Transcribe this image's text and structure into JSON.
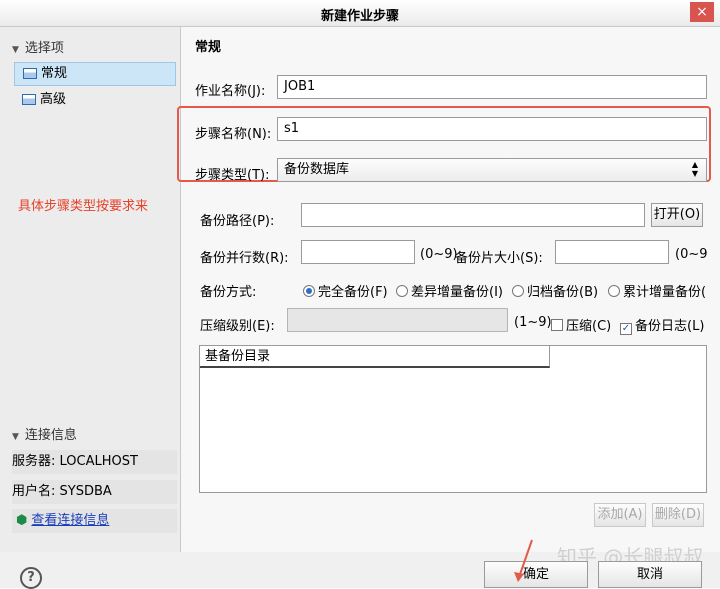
{
  "window": {
    "title": "新建作业步骤",
    "close": "×"
  },
  "sidebar": {
    "section_title": "选择项",
    "items": [
      {
        "label": "常规"
      },
      {
        "label": "高级"
      }
    ],
    "annotation": "具体步骤类型按要求来",
    "connection": {
      "title": "连接信息",
      "server": "服务器: LOCALHOST",
      "user": "用户名: SYSDBA",
      "link": "查看连接信息"
    }
  },
  "general": {
    "heading": "常规",
    "job_name_label": "作业名称(J):",
    "job_name_value": "JOB1",
    "step_name_label": "步骤名称(N):",
    "step_name_value": "s1",
    "step_type_label": "步骤类型(T):",
    "step_type_value": "备份数据库",
    "backup_path_label": "备份路径(P):",
    "backup_path_value": "",
    "open_button": "打开(O)",
    "parallel_label": "备份并行数(R):",
    "parallel_range": "(0~9)",
    "piece_label": "备份片大小(S):",
    "piece_range": "(0~9",
    "method_label": "备份方式:",
    "methods": [
      "完全备份(F)",
      "差异增量备份(I)",
      "归档备份(B)",
      "累计增量备份("
    ],
    "compress_label": "压缩级别(E):",
    "compress_range": "(1~9)",
    "compress_check": "压缩(C)",
    "log_check": "备份日志(L)",
    "table_header": "基备份目录",
    "add_button": "添加(A)",
    "delete_button": "删除(D)"
  },
  "footer": {
    "help": "?",
    "ok": "确定",
    "cancel": "取消",
    "watermark": "知乎 @长腿叔叔"
  }
}
